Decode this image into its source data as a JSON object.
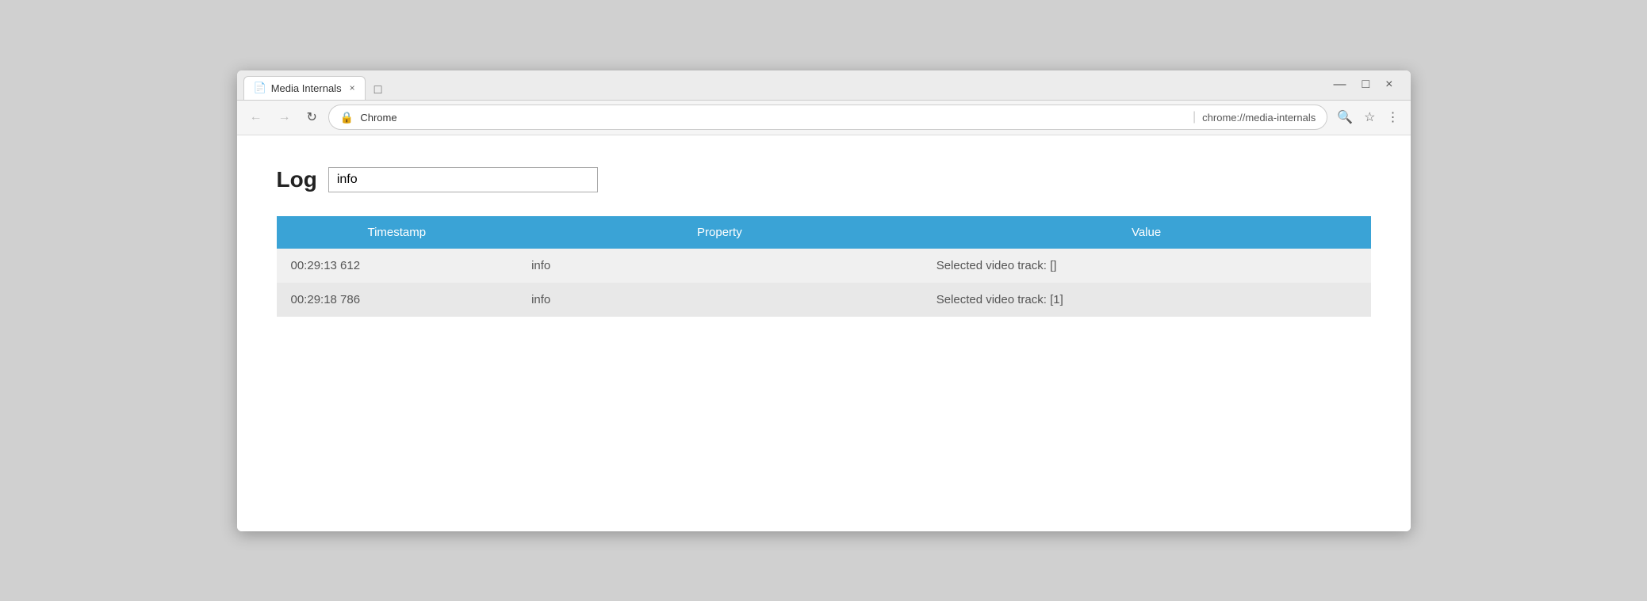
{
  "browser": {
    "tab_title": "Media Internals",
    "tab_icon": "📄",
    "close_char": "×",
    "new_tab_char": "□",
    "win_minimize": "—",
    "win_maximize": "□",
    "win_close": "×",
    "nav_back": "←",
    "nav_forward": "→",
    "nav_reload": "↻",
    "secure_icon": "🔒",
    "url_domain": "Chrome",
    "url_divider": "|",
    "url_address": "chrome://media-internals",
    "search_icon": "🔍",
    "star_icon": "☆",
    "more_icon": "⋮"
  },
  "page": {
    "log_label": "Log",
    "log_input_value": "info",
    "table": {
      "col_timestamp": "Timestamp",
      "col_property": "Property",
      "col_value": "Value",
      "rows": [
        {
          "timestamp": "00:29:13 612",
          "property": "info",
          "value": "Selected video track: []"
        },
        {
          "timestamp": "00:29:18 786",
          "property": "info",
          "value": "Selected video track: [1]"
        }
      ]
    }
  }
}
